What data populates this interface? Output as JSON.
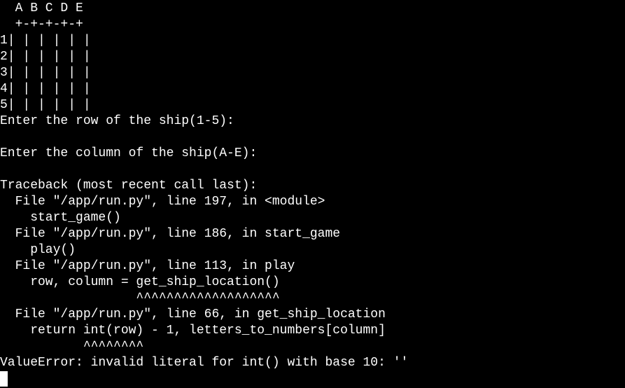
{
  "terminal": {
    "colors": {
      "background": "#000000",
      "foreground": "#ffffff"
    },
    "lines": [
      "  A B C D E",
      "  +-+-+-+-+",
      "1| | | | | |",
      "2| | | | | |",
      "3| | | | | |",
      "4| | | | | |",
      "5| | | | | |",
      "Enter the row of the ship(1-5):",
      "",
      "Enter the column of the ship(A-E):",
      "",
      "Traceback (most recent call last):",
      "  File \"/app/run.py\", line 197, in <module>",
      "    start_game()",
      "  File \"/app/run.py\", line 186, in start_game",
      "    play()",
      "  File \"/app/run.py\", line 113, in play",
      "    row, column = get_ship_location()",
      "                  ^^^^^^^^^^^^^^^^^^^",
      "  File \"/app/run.py\", line 66, in get_ship_location",
      "    return int(row) - 1, letters_to_numbers[column]",
      "           ^^^^^^^^",
      "ValueError: invalid literal for int() with base 10: ''"
    ]
  }
}
